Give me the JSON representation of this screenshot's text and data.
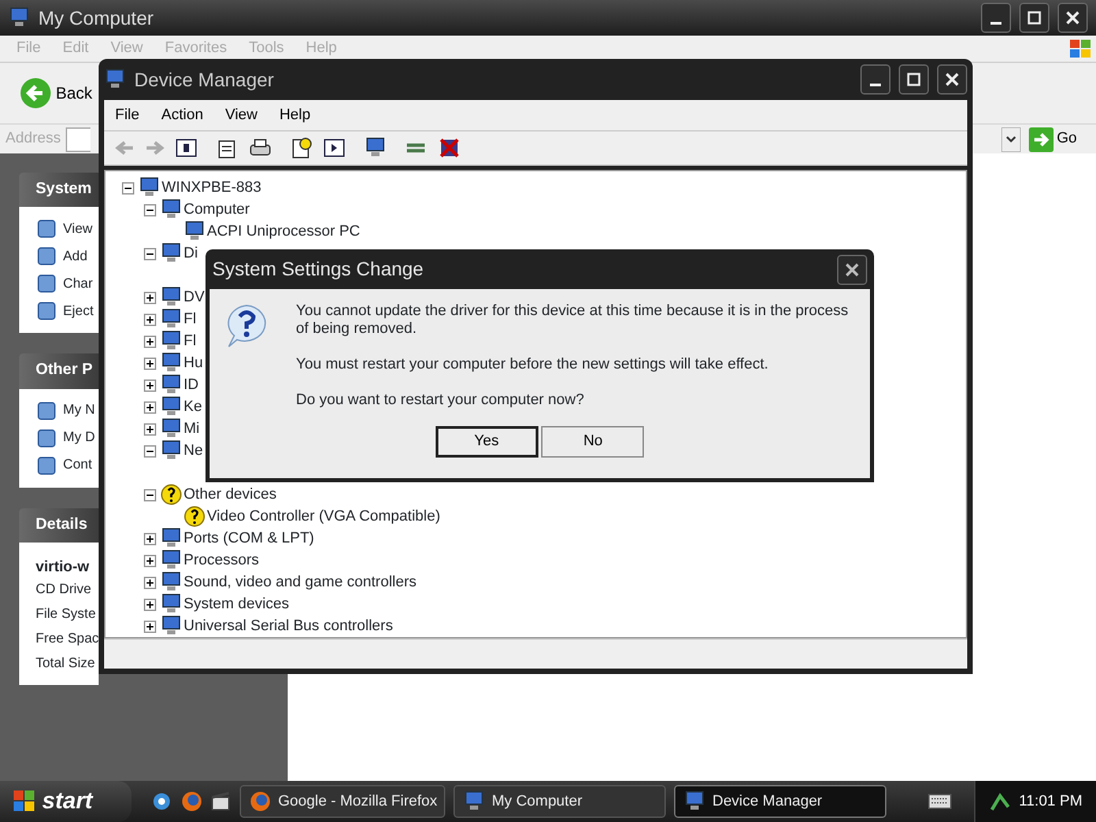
{
  "explorer": {
    "title": "My Computer",
    "menu": [
      {
        "label": "File"
      },
      {
        "label": "Edit"
      },
      {
        "label": "View"
      },
      {
        "label": "Favorites"
      },
      {
        "label": "Tools"
      },
      {
        "label": "Help"
      }
    ],
    "back": "Back",
    "address_label": "Address",
    "go": "Go",
    "task_panels": [
      {
        "title": "System",
        "items": [
          "View",
          "Add",
          "Char",
          "Eject"
        ]
      },
      {
        "title": "Other P",
        "items": [
          "My N",
          "My D",
          "Cont"
        ]
      }
    ],
    "details": {
      "title": "Details",
      "name": "virtio-w",
      "lines": [
        "CD Drive",
        "File Syste",
        "Free Spac",
        "Total Size"
      ]
    }
  },
  "device_manager": {
    "title": "Device Manager",
    "menu": [
      "File",
      "Action",
      "View",
      "Help"
    ],
    "tree": {
      "label": "WINXPBE-883",
      "expanded": true,
      "children": [
        {
          "label": "Computer",
          "expanded": true,
          "children": [
            {
              "label": "ACPI Uniprocessor PC"
            }
          ]
        },
        {
          "label": "Di",
          "expanded": true
        },
        {
          "label": "DV",
          "expanded": false
        },
        {
          "label": "Fl",
          "expanded": false
        },
        {
          "label": "Fl",
          "expanded": false
        },
        {
          "label": "Hu",
          "expanded": false
        },
        {
          "label": "ID",
          "expanded": false
        },
        {
          "label": "Ke",
          "expanded": false
        },
        {
          "label": "Mi",
          "expanded": false
        },
        {
          "label": "Ne",
          "expanded": true
        },
        {
          "label": "Other devices",
          "expanded": true,
          "warning": true,
          "children": [
            {
              "label": "Video Controller (VGA Compatible)",
              "warning": true
            }
          ]
        },
        {
          "label": "Ports (COM & LPT)",
          "expanded": false
        },
        {
          "label": "Processors",
          "expanded": false
        },
        {
          "label": "Sound, video and game controllers",
          "expanded": false
        },
        {
          "label": "System devices",
          "expanded": false
        },
        {
          "label": "Universal Serial Bus controllers",
          "expanded": false
        }
      ]
    }
  },
  "dialog": {
    "title": "System Settings Change",
    "paragraphs": [
      "You cannot update the driver for this device at this time because it is in the process of being removed.",
      "You must restart your computer before the new settings will take effect.",
      "Do you want to restart your computer now?"
    ],
    "buttons": [
      {
        "label": "Yes",
        "default": true
      },
      {
        "label": "No",
        "default": false
      }
    ]
  },
  "taskbar": {
    "start": "start",
    "tasks": [
      {
        "label": "Google - Mozilla Firefox",
        "selected": false
      },
      {
        "label": "My Computer",
        "selected": false
      },
      {
        "label": "Device Manager",
        "selected": true
      }
    ],
    "clock": "11:01 PM"
  }
}
